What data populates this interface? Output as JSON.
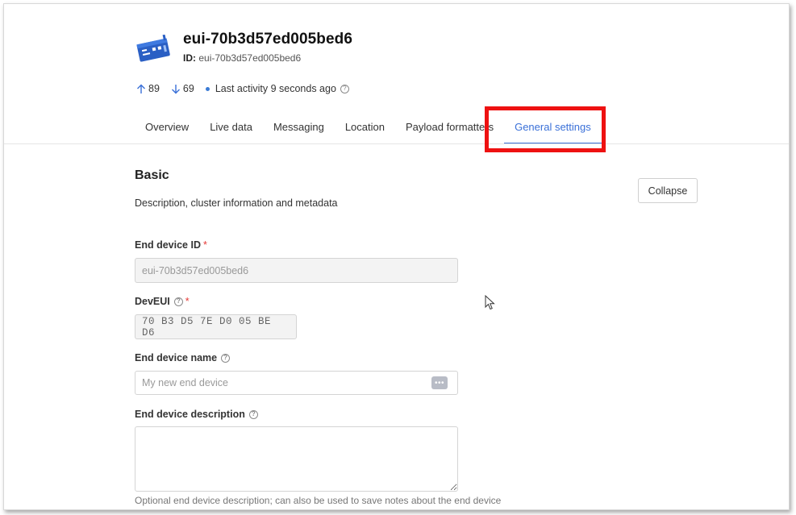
{
  "device": {
    "title": "eui-70b3d57ed005bed6",
    "id_label": "ID:",
    "id_value": "eui-70b3d57ed005bed6",
    "icon": "device-board-icon"
  },
  "stats": {
    "uplink_count": "89",
    "downlink_count": "69",
    "last_activity": "Last activity 9 seconds ago"
  },
  "tabs": [
    {
      "label": "Overview"
    },
    {
      "label": "Live data"
    },
    {
      "label": "Messaging"
    },
    {
      "label": "Location"
    },
    {
      "label": "Payload formatters"
    },
    {
      "label": "General settings",
      "active": true
    }
  ],
  "section": {
    "title": "Basic",
    "description": "Description, cluster information and metadata",
    "collapse_label": "Collapse"
  },
  "form": {
    "end_device_id": {
      "label": "End device ID",
      "required": "*",
      "value": "eui-70b3d57ed005bed6"
    },
    "dev_eui": {
      "label": "DevEUI",
      "required": "*",
      "value": "70 B3 D5 7E D0 05 BE D6"
    },
    "end_device_name": {
      "label": "End device name",
      "placeholder": "My new end device",
      "value": ""
    },
    "end_device_description": {
      "label": "End device description",
      "value": "",
      "hint": "Optional end device description; can also be used to save notes about the end device"
    }
  },
  "colors": {
    "accent": "#3a70d8",
    "highlight": "#ee1111",
    "required": "#e53935"
  }
}
